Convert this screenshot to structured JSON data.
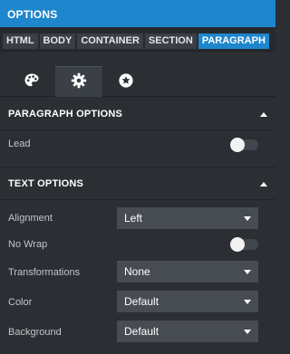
{
  "window": {
    "title": "OPTIONS"
  },
  "breadcrumb": [
    "HTML",
    "BODY",
    "CONTAINER",
    "SECTION",
    "PARAGRAPH"
  ],
  "active_crumb": "PARAGRAPH",
  "tabs": [
    {
      "icon": "palette-icon"
    },
    {
      "icon": "gear-icon",
      "active": true
    },
    {
      "icon": "star-icon"
    }
  ],
  "paragraph_options": {
    "title": "PARAGRAPH OPTIONS",
    "lead": {
      "label": "Lead",
      "on": false
    }
  },
  "text_options": {
    "title": "TEXT OPTIONS",
    "alignment": {
      "label": "Alignment",
      "value": "Left"
    },
    "nowrap": {
      "label": "No Wrap",
      "on": false
    },
    "transformations": {
      "label": "Transformations",
      "value": "None"
    },
    "color": {
      "label": "Color",
      "value": "Default"
    },
    "background": {
      "label": "Background",
      "value": "Default"
    }
  },
  "colors": {
    "accent": "#1e86cc",
    "panel": "#2b2e33",
    "control": "#474c53"
  }
}
